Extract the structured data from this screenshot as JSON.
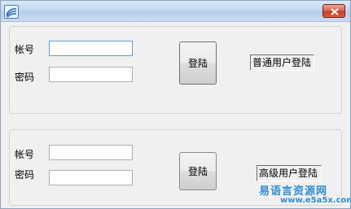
{
  "window": {
    "app_icon": "app-icon",
    "close_icon": "close-icon"
  },
  "group1": {
    "account_label": "帐号",
    "password_label": "密码",
    "account_value": "",
    "password_value": "",
    "login_button": "登陆",
    "status_text": "普通用户登陆"
  },
  "group2": {
    "account_label": "帐号",
    "password_label": "密码",
    "account_value": "",
    "password_value": "",
    "login_button": "登陆",
    "status_text": "高级用户登陆"
  },
  "watermark": {
    "title": "易语言资源网",
    "url": "www.e5a5x.com"
  },
  "colors": {
    "accent": "#2f8fd3",
    "close": "#c84129"
  }
}
